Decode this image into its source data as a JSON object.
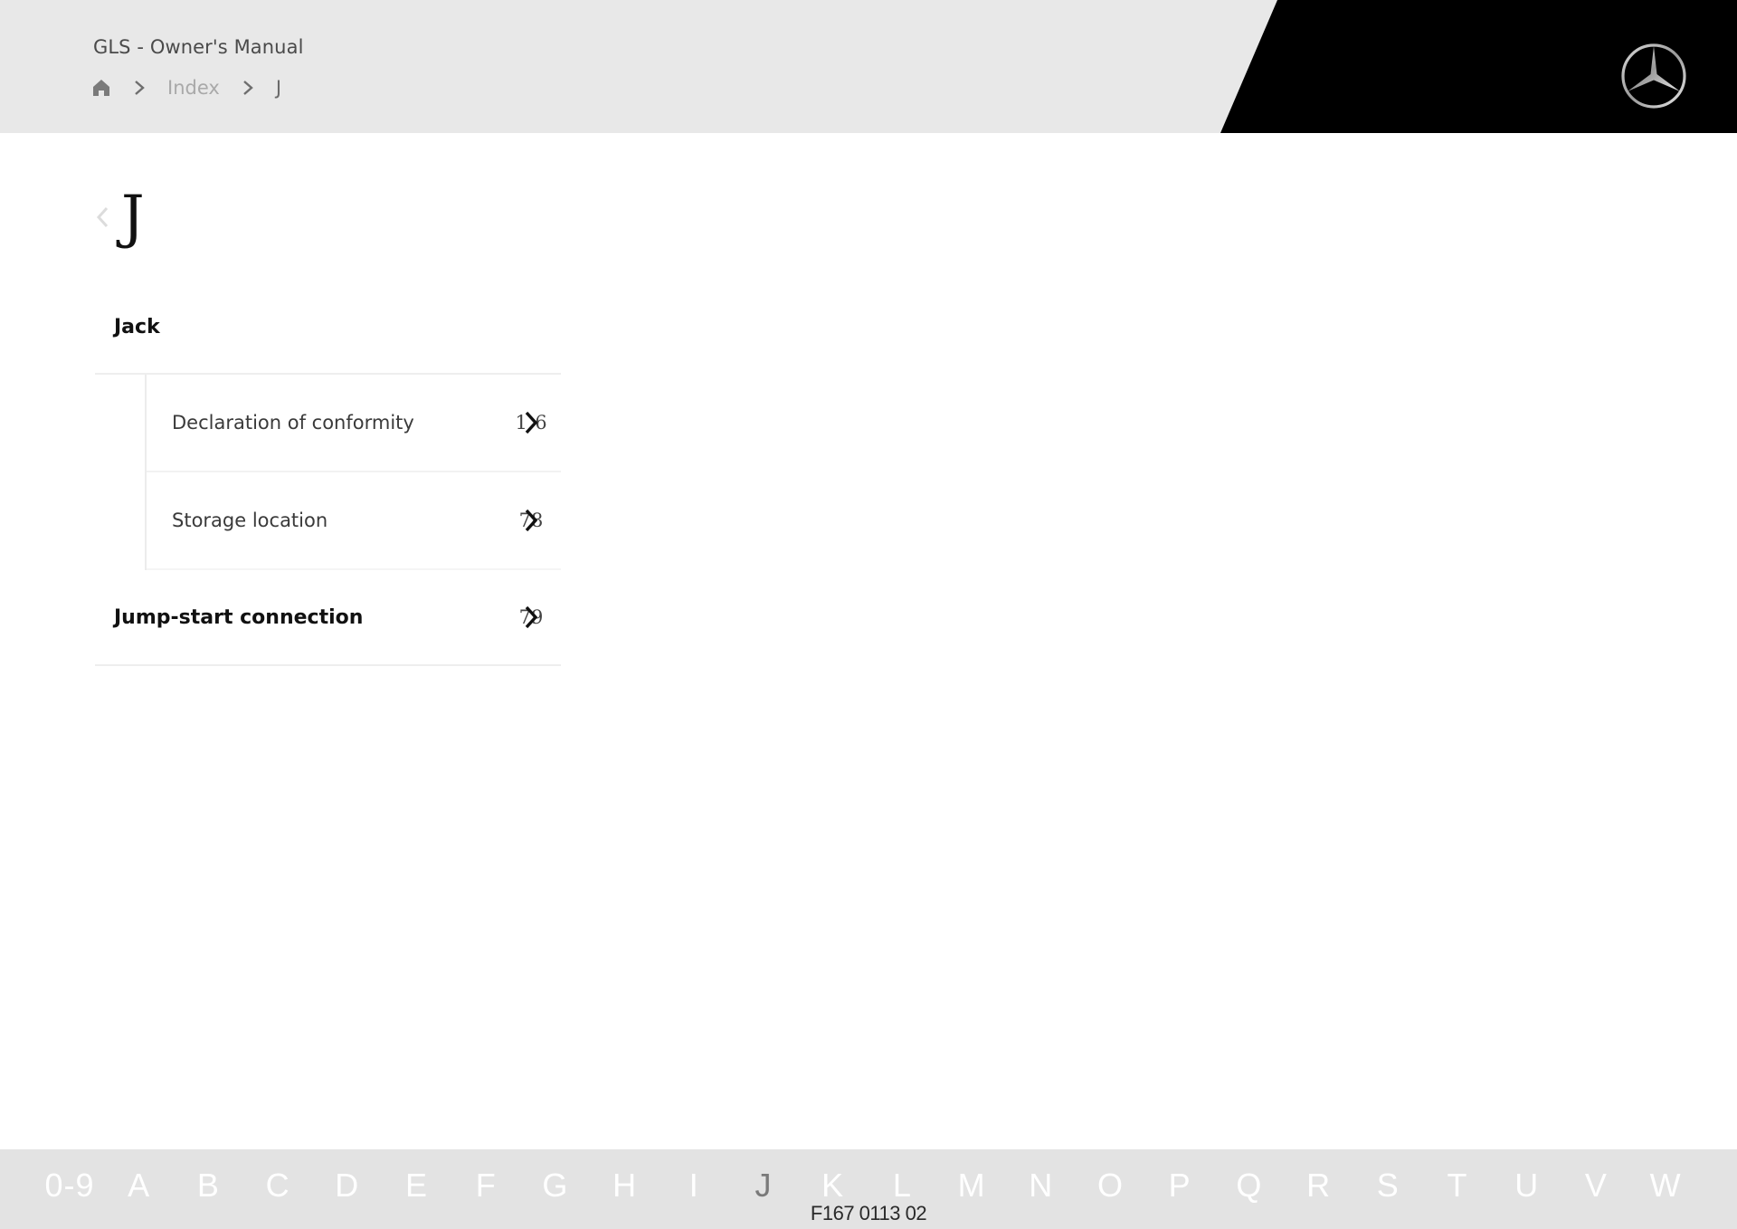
{
  "header": {
    "app_title": "GLS - Owner's Manual",
    "breadcrumb": {
      "home_icon": "home-icon",
      "separator_icon": "chevron-right-icon",
      "items": [
        "Index",
        "J"
      ]
    },
    "logo": "mercedes-star-logo"
  },
  "main": {
    "back_icon": "chevron-left-icon",
    "letter": "J",
    "entries": [
      {
        "label": "Jack",
        "subentries": [
          {
            "label": "Declaration of conformity",
            "page_visible": "1 6",
            "page_digits_left": "1",
            "page_digits_right": "6"
          },
          {
            "label": "Storage location",
            "page_visible": "78",
            "page_digits_left": "7",
            "page_digits_right": "8"
          }
        ]
      },
      {
        "label": "Jump-start connection",
        "page_visible": "79",
        "page_digits_left": "7",
        "page_digits_right": "9"
      }
    ],
    "page_link_icon": "chevron-right-icon"
  },
  "alphabet": {
    "letters": [
      "0-9",
      "A",
      "B",
      "C",
      "D",
      "E",
      "F",
      "G",
      "H",
      "I",
      "J",
      "K",
      "L",
      "M",
      "N",
      "O",
      "P",
      "Q",
      "R",
      "S",
      "T",
      "U",
      "V",
      "W"
    ],
    "active": "J"
  },
  "caption": "F167 0113 02",
  "colors": {
    "header_bg": "#e8e8e8",
    "brand_black": "#000000",
    "alphabet_bg": "#e3e3e3",
    "active_letter": "#7a7a7a"
  }
}
